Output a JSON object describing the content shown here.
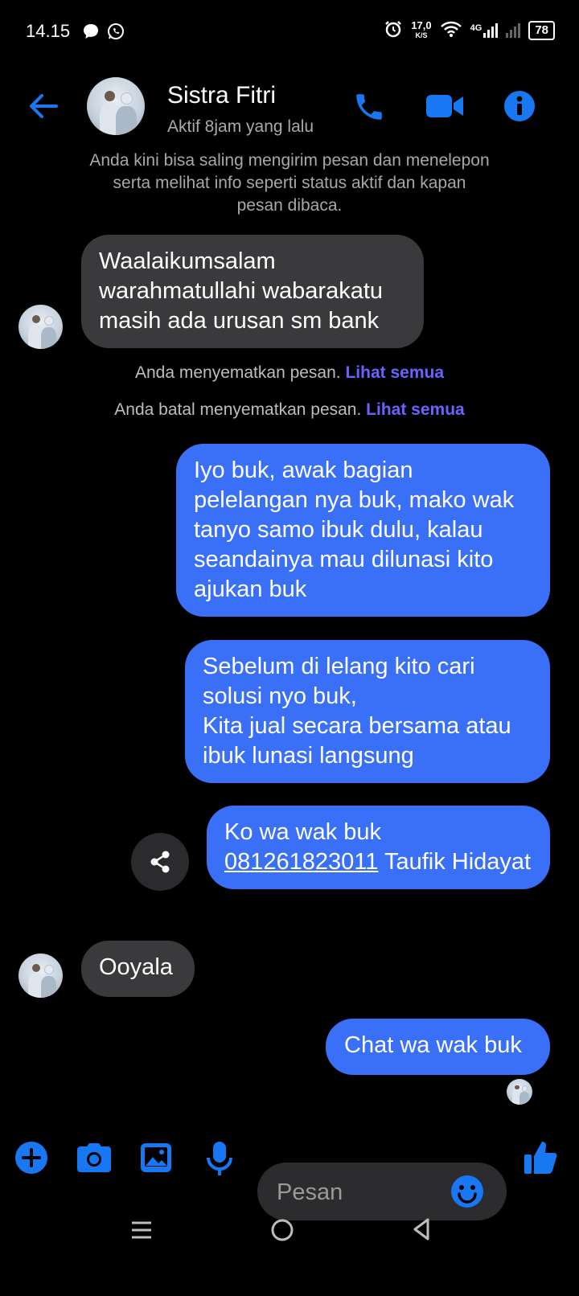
{
  "status_bar": {
    "time": "14.15",
    "net_speed": "17,0",
    "net_unit": "K/S",
    "network": "4G",
    "battery": "78"
  },
  "header": {
    "contact_name": "Sistra Fitri",
    "contact_status": "Aktif 8jam yang lalu"
  },
  "system_note": "Anda kini bisa saling mengirim pesan dan menelepon serta melihat info seperti status aktif dan kapan pesan dibaca.",
  "messages": [
    {
      "from": "them",
      "text": "Waalaikumsalam warahmatullahi wabarakatu masih ada urusan sm bank"
    },
    {
      "from": "me",
      "text": "Iyo buk, awak bagian pelelangan nya buk, mako wak tanyo samo ibuk dulu, kalau seandainya mau dilunasi kito ajukan buk"
    },
    {
      "from": "me",
      "text_line1": "Sebelum di lelang kito cari solusi nyo buk,",
      "text_line2": "Kita jual secara bersama atau ibuk lunasi langsung"
    },
    {
      "from": "me",
      "text_prefix": "Ko wa wak buk",
      "phone_link": "081261823011",
      "text_suffix": "Taufik Hidayat"
    },
    {
      "from": "them",
      "text": "Ooyala"
    },
    {
      "from": "me",
      "text": "Chat wa wak buk"
    }
  ],
  "pin_notes": [
    {
      "text": "Anda menyematkan pesan.",
      "link": "Lihat semua"
    },
    {
      "text": "Anda batal menyematkan pesan.",
      "link": "Lihat semua"
    }
  ],
  "composer": {
    "placeholder": "Pesan"
  },
  "icons": {
    "back": "back-arrow-icon",
    "call": "phone-icon",
    "video": "video-camera-icon",
    "info": "info-icon",
    "plus": "plus-icon",
    "camera": "camera-icon",
    "gallery": "image-icon",
    "mic": "microphone-icon",
    "emoji": "emoji-icon",
    "like": "thumbs-up-icon",
    "share": "share-icon"
  },
  "colors": {
    "accent": "#1877f2",
    "outgoing_bubble": "#3a6ff8",
    "incoming_bubble": "#3a3a3c",
    "link": "#6c63ff"
  }
}
